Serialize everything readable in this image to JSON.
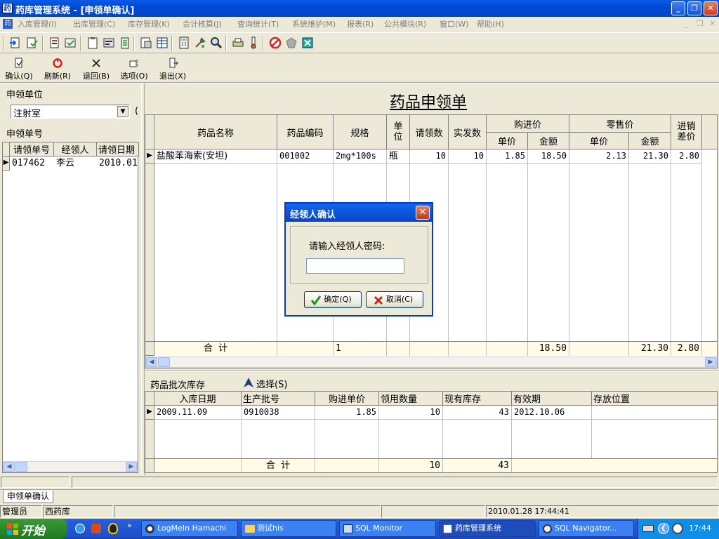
{
  "window": {
    "title": "药库管理系统 - [申领单确认]",
    "minimize": "_",
    "restore": "❐",
    "close": "✕"
  },
  "menu": [
    "入库管理(I)",
    "出库管理(C)",
    "库存管理(K)",
    "会计核算(J)",
    "查询统计(T)",
    "系统维护(M)",
    "报表(R)",
    "公共模块(R)",
    "窗口(W)",
    "帮助(H)"
  ],
  "commands": [
    {
      "label": "确认(Q)",
      "icon": "confirm-icon"
    },
    {
      "label": "刷新(R)",
      "icon": "refresh-icon"
    },
    {
      "label": "退回(B)",
      "icon": "return-icon"
    },
    {
      "label": "选项(O)",
      "icon": "options-icon"
    },
    {
      "label": "退出(X)",
      "icon": "exit-icon"
    }
  ],
  "left": {
    "unit_label": "申领单位",
    "unit_value": "注射室",
    "unit_extra": "(",
    "list_label": "申领单号",
    "columns": [
      "请领单号",
      "经领人",
      "请领日期"
    ],
    "rows": [
      {
        "no": "017462",
        "person": "李云",
        "date": "2010.01"
      }
    ]
  },
  "main": {
    "title": "药品申领单",
    "columns": {
      "name": "药品名称",
      "code": "药品编码",
      "spec": "规格",
      "unit": "单位",
      "req_qty": "请领数",
      "issue_qty": "实发数",
      "buy_price": "购进价",
      "retail_price": "零售价",
      "unit_price": "单价",
      "amount": "金额",
      "diff": "进销差价"
    },
    "rows": [
      {
        "name": "盐酸苯海索(安坦)",
        "code": "001002",
        "spec": "2mg*100s",
        "unit": "瓶",
        "req_qty": "10",
        "issue_qty": "10",
        "buy_price": "1.85",
        "buy_amount": "18.50",
        "retail_price": "2.13",
        "retail_amount": "21.30",
        "diff": "2.80"
      }
    ],
    "total": {
      "label": "合  计",
      "spec": "1",
      "buy_amount": "18.50",
      "retail_amount": "21.30",
      "diff": "2.80"
    }
  },
  "batch": {
    "label": "药品批次库存",
    "select_label": "选择(S)",
    "columns": [
      "入库日期",
      "生产批号",
      "购进单价",
      "领用数量",
      "现有库存",
      "有效期",
      "存放位置"
    ],
    "rows": [
      {
        "in_date": "2009.11.09",
        "batch_no": "0910038",
        "price": "1.85",
        "qty": "10",
        "stock": "43",
        "expiry": "2012.10.06",
        "location": ""
      }
    ],
    "total": {
      "label": "合  计",
      "qty": "10",
      "stock": "43"
    }
  },
  "dialog": {
    "title": "经领人确认",
    "prompt": "请输入经领人密码:",
    "password": "",
    "ok_label": "确定(Q)",
    "cancel_label": "取消(C)"
  },
  "window_tab": "申领单确认",
  "status": {
    "user": "管理员",
    "store": "西药库",
    "datetime": "2010.01.28 17:44:41"
  },
  "taskbar": {
    "start": "开始",
    "tasks": [
      "LogMeIn Hamachi",
      "测试his",
      "SQL Monitor",
      "药库管理系统",
      "SQL Navigator..."
    ],
    "clock": "17:44",
    "quicklaunch_more": "»"
  },
  "colors": {
    "title_bar": "#0349d6",
    "taskbar": "#245edb",
    "start_button": "#2b8a2b",
    "total_row": "#fffbe6",
    "dialog_border": "#0a3ac2"
  }
}
